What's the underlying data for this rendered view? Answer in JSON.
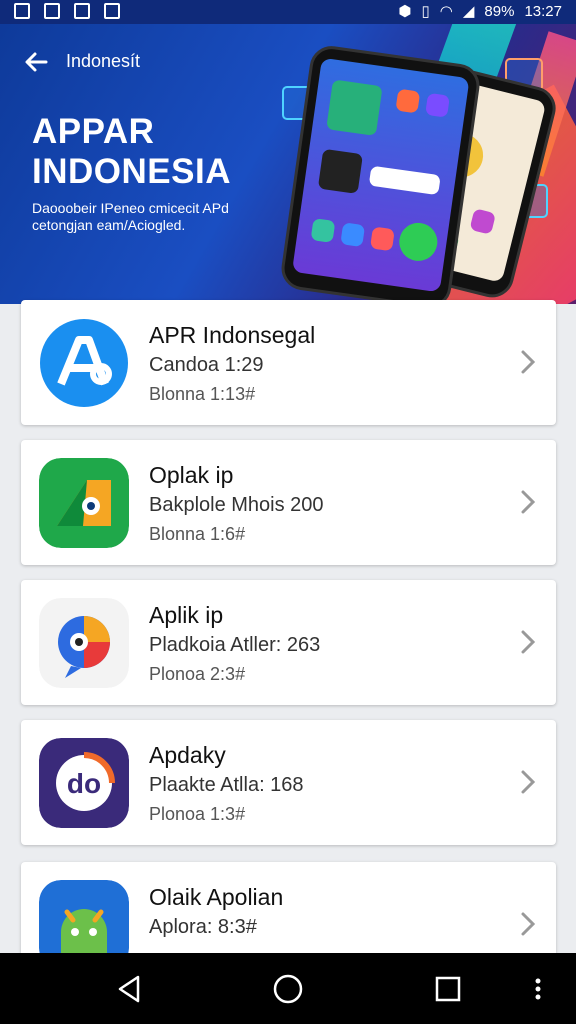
{
  "status_bar": {
    "battery": "89%",
    "time": "13:27"
  },
  "header": {
    "back_icon": "arrow-left-icon",
    "subtitle": "Indonesít",
    "title": "APPAR INDONESIA",
    "description": "Daooobeir IPeneo cmicecit APd cetongjan eam/Aciogled."
  },
  "apps": [
    {
      "name": "APR Indonsegal",
      "line2": "Candoa 1:29",
      "line3": "Blonna 1:13#",
      "icon": "app-a-icon"
    },
    {
      "name": "Oplak ip",
      "line2": "Bakplole Mhois 200",
      "line3": "Blonna 1:6#",
      "icon": "app-green-icon"
    },
    {
      "name": "Aplik ip",
      "line2": "Pladkoia Atller: 263",
      "line3": "Plonoa 2:3#",
      "icon": "app-chat-icon"
    },
    {
      "name": "Apdaky",
      "line2": "Plaakte Atlla: 168",
      "line3": "Plonoa 1:3#",
      "icon": "app-do-icon"
    },
    {
      "name": "Olaik Apolian",
      "line2": "Aplora: 8:3#",
      "line3": "",
      "icon": "app-android-icon"
    }
  ],
  "nav": {
    "back": "nav-back-icon",
    "home": "nav-home-icon",
    "recent": "nav-recent-icon",
    "more": "nav-more-icon"
  },
  "colors": {
    "status_bar": "#0f2a7a",
    "hero_primary": "#1a4ec2",
    "accent_orange": "#ff7a1a",
    "card_bg": "#ffffff",
    "page_bg": "#ebedf0"
  }
}
